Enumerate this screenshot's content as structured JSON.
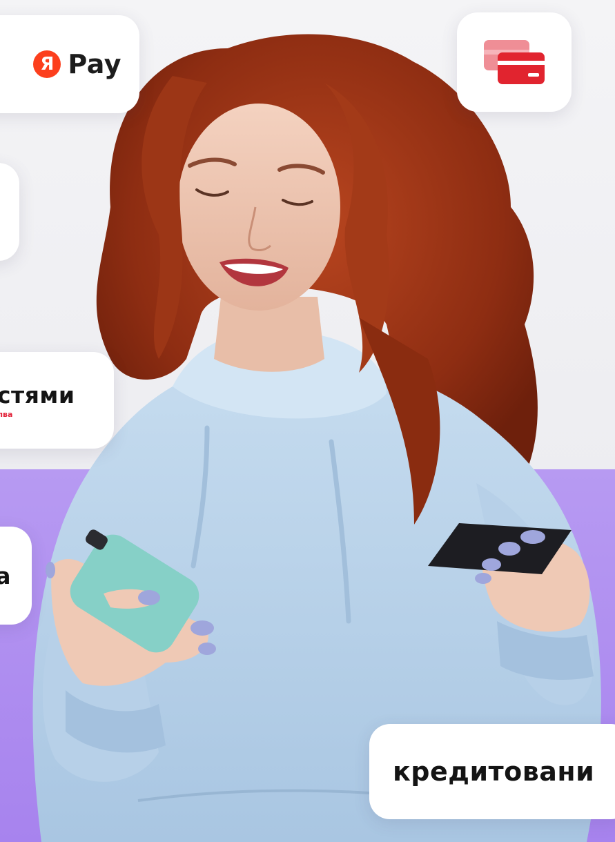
{
  "badges": {
    "yandex_pay": {
      "logo_letter": "Я",
      "label": "Pay"
    },
    "card_icon": "credit-cards-icon",
    "installments": {
      "label": "стями",
      "sublabel": "лва"
    },
    "partial": {
      "label": "а"
    },
    "credit": {
      "label": "кредитовани"
    }
  },
  "colors": {
    "purple_band": "#b08ff0",
    "yandex_red": "#fc3f1d",
    "card_red": "#e1242f",
    "card_pink": "#ef8e96"
  }
}
